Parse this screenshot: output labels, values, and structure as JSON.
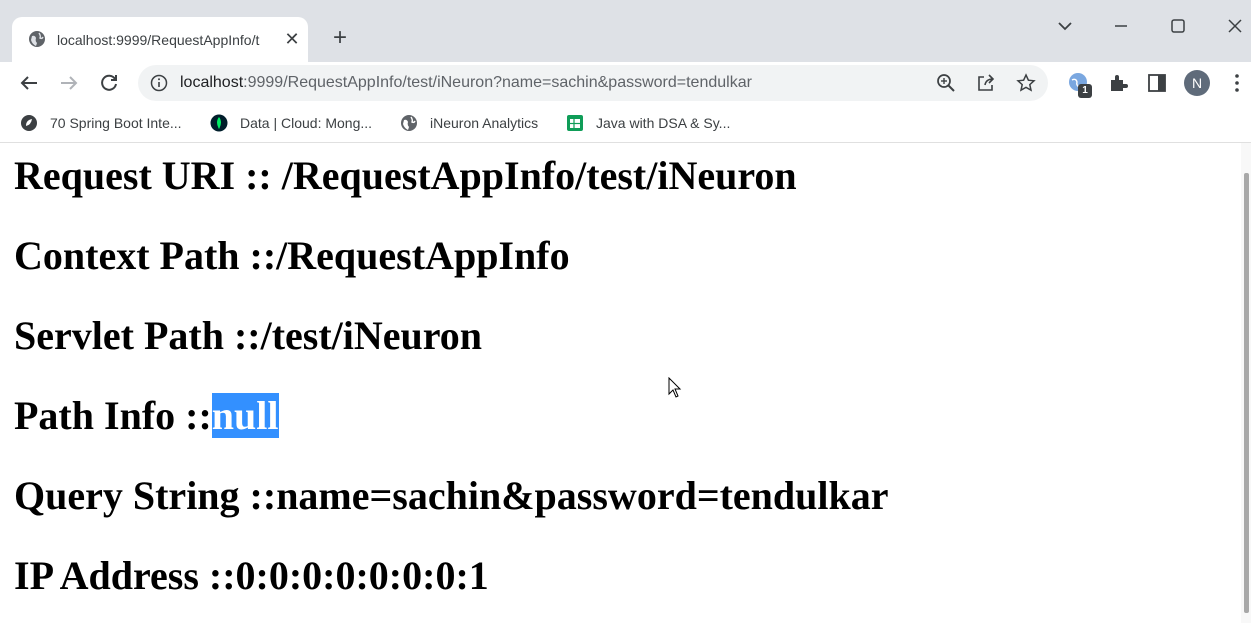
{
  "tab": {
    "title": "localhost:9999/RequestAppInfo/t",
    "close_glyph": "✕",
    "favicon_icon": "globe-icon"
  },
  "new_tab_glyph": "+",
  "address_bar": {
    "host": "localhost",
    "rest": ":9999/RequestAppInfo/test/iNeuron?name=sachin&password=tendulkar"
  },
  "profile": {
    "initial": "N"
  },
  "extension_badge": "1",
  "bookmarks": [
    {
      "label": "70 Spring Boot Inte...",
      "icon": "spring-icon"
    },
    {
      "label": "Data | Cloud: Mong...",
      "icon": "mongodb-leaf-icon"
    },
    {
      "label": "iNeuron Analytics",
      "icon": "globe-icon"
    },
    {
      "label": "Java with DSA & Sy...",
      "icon": "sheets-icon"
    }
  ],
  "page": {
    "request_uri": "Request URI :: /RequestAppInfo/test/iNeuron",
    "context_path": "Context Path ::/RequestAppInfo",
    "servlet_path": "Servlet Path ::/test/iNeuron",
    "path_info_label": "Path Info ::",
    "path_info_value": "null",
    "query_string": "Query String ::name=sachin&password=tendulkar",
    "ip_address": "IP Address ::0:0:0:0:0:0:0:1"
  },
  "colors": {
    "selection": "#3390ff",
    "chrome_frame": "#dee1e6",
    "omnibox": "#f1f3f4"
  }
}
